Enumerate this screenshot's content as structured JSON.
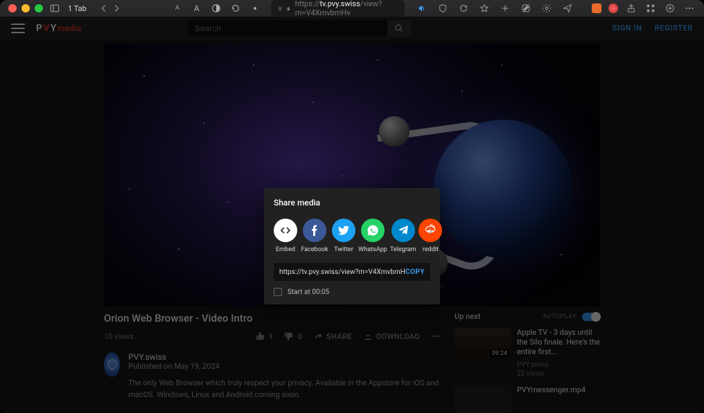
{
  "browser": {
    "tab_label": "1 Tab",
    "url_host": "tv.pvy.swiss",
    "url_prefix": "https://",
    "url_path": "/view?m=V4XmvbmHv"
  },
  "header": {
    "logo_p": "P",
    "logo_v": "V",
    "logo_y": "Y",
    "logo_media": "media",
    "search_placeholder": "Search",
    "sign_in": "SIGN IN",
    "register": "REGISTER"
  },
  "video": {
    "title": "Orion Web Browser - Video Intro",
    "views": "10 views",
    "like_count": "1",
    "dislike_count": "0",
    "share_label": "SHARE",
    "download_label": "DOWNLOAD"
  },
  "channel": {
    "name": "PVY.swiss",
    "published": "Published on May 19, 2024",
    "description": "The only Web Browser which  truly respect your privacy.  Available in the Appstore for iOS and macOS. Windows, Linux and Android coming soon."
  },
  "upnext": {
    "label": "Up next",
    "autoplay": "AUTOPLAY",
    "items": [
      {
        "title": "Apple TV - 3 days until the Silo finale. Here's the entire first...",
        "channel": "PVY.swiss",
        "views": "22 views",
        "duration": "59:24"
      },
      {
        "title": "PVYmessenger.mp4"
      }
    ]
  },
  "modal": {
    "title": "Share media",
    "options": [
      {
        "label": "Embed"
      },
      {
        "label": "Facebook"
      },
      {
        "label": "Twitter"
      },
      {
        "label": "WhatsApp"
      },
      {
        "label": "Telegram"
      },
      {
        "label": "reddit"
      }
    ],
    "url": "https://tv.pvy.swiss/view?m=V4XmvbmHv",
    "copy": "COPY",
    "start_at": "Start at 00:05"
  }
}
